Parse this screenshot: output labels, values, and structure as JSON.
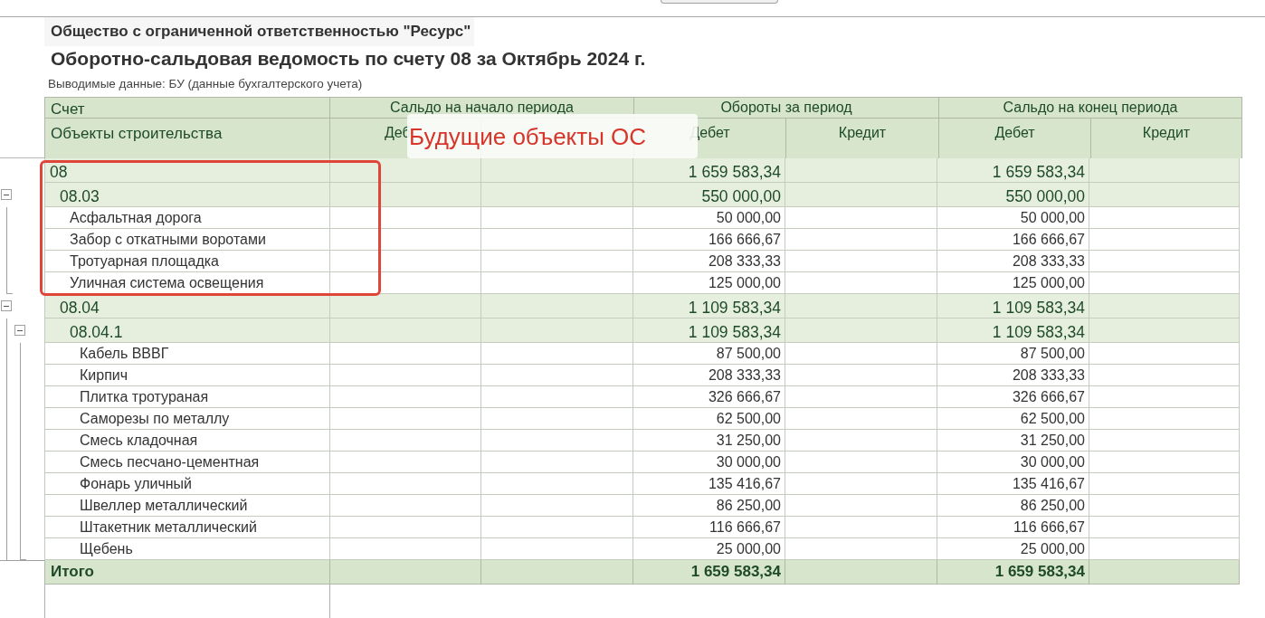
{
  "company": "Общество с ограниченной ответственностью \"Ресурс\"",
  "title": "Оборотно-сальдовая ведомость по счету 08 за Октябрь 2024 г.",
  "subtitle": "Выводимые данные: БУ (данные бухгалтерского учета)",
  "header": {
    "account": "Счет",
    "subconto": "Объекты строительства",
    "groups": [
      {
        "label": "Сальдо на начало периода",
        "columns": [
          "Деб"
        ]
      },
      {
        "label": "Обороты за период",
        "columns": [
          "Дебет",
          "Кредит"
        ]
      },
      {
        "label": "Сальдо на конец периода",
        "columns": [
          "Дебет",
          "Кредит"
        ]
      }
    ]
  },
  "rows": [
    {
      "kind": "group",
      "label": "08",
      "turnover_debit": "1 659 583,34",
      "closing_debit": "1 659 583,34",
      "children": [
        {
          "kind": "group",
          "label": "08.03",
          "expanded": true,
          "turnover_debit": "550 000,00",
          "closing_debit": "550 000,00",
          "children": [
            {
              "kind": "item",
              "label": "Асфальтная дорога",
              "turnover_debit": "50 000,00",
              "closing_debit": "50 000,00"
            },
            {
              "kind": "item",
              "label": "Забор с откатными воротами",
              "turnover_debit": "166 666,67",
              "closing_debit": "166 666,67"
            },
            {
              "kind": "item",
              "label": "Тротуарная площадка",
              "turnover_debit": "208 333,33",
              "closing_debit": "208 333,33"
            },
            {
              "kind": "item",
              "label": "Уличная система освещения",
              "turnover_debit": "125 000,00",
              "closing_debit": "125 000,00"
            }
          ]
        },
        {
          "kind": "group",
          "label": "08.04",
          "expanded": true,
          "turnover_debit": "1 109 583,34",
          "closing_debit": "1 109 583,34",
          "children": [
            {
              "kind": "group",
              "label": "08.04.1",
              "expanded": true,
              "turnover_debit": "1 109 583,34",
              "closing_debit": "1 109 583,34",
              "children": [
                {
                  "kind": "item",
                  "label": "Кабель ВВВГ",
                  "turnover_debit": "87 500,00",
                  "closing_debit": "87 500,00"
                },
                {
                  "kind": "item",
                  "label": "Кирпич",
                  "turnover_debit": "208 333,33",
                  "closing_debit": "208 333,33"
                },
                {
                  "kind": "item",
                  "label": "Плитка тротураная",
                  "turnover_debit": "326 666,67",
                  "closing_debit": "326 666,67"
                },
                {
                  "kind": "item",
                  "label": "Саморезы по металлу",
                  "turnover_debit": "62 500,00",
                  "closing_debit": "62 500,00"
                },
                {
                  "kind": "item",
                  "label": "Смесь кладочная",
                  "turnover_debit": "31 250,00",
                  "closing_debit": "31 250,00"
                },
                {
                  "kind": "item",
                  "label": "Смесь песчано-цементная",
                  "turnover_debit": "30 000,00",
                  "closing_debit": "30 000,00"
                },
                {
                  "kind": "item",
                  "label": "Фонарь уличный",
                  "turnover_debit": "135 416,67",
                  "closing_debit": "135 416,67"
                },
                {
                  "kind": "item",
                  "label": "Швеллер металлический",
                  "turnover_debit": "86 250,00",
                  "closing_debit": "86 250,00"
                },
                {
                  "kind": "item",
                  "label": "Штакетник металлический",
                  "turnover_debit": "116 666,67",
                  "closing_debit": "116 666,67"
                },
                {
                  "kind": "item",
                  "label": "Щебень",
                  "turnover_debit": "25 000,00",
                  "closing_debit": "25 000,00"
                }
              ]
            }
          ]
        }
      ]
    }
  ],
  "total": {
    "label": "Итого",
    "turnover_debit": "1 659 583,34",
    "closing_debit": "1 659 583,34"
  },
  "note": "Будущие объекты ОС"
}
